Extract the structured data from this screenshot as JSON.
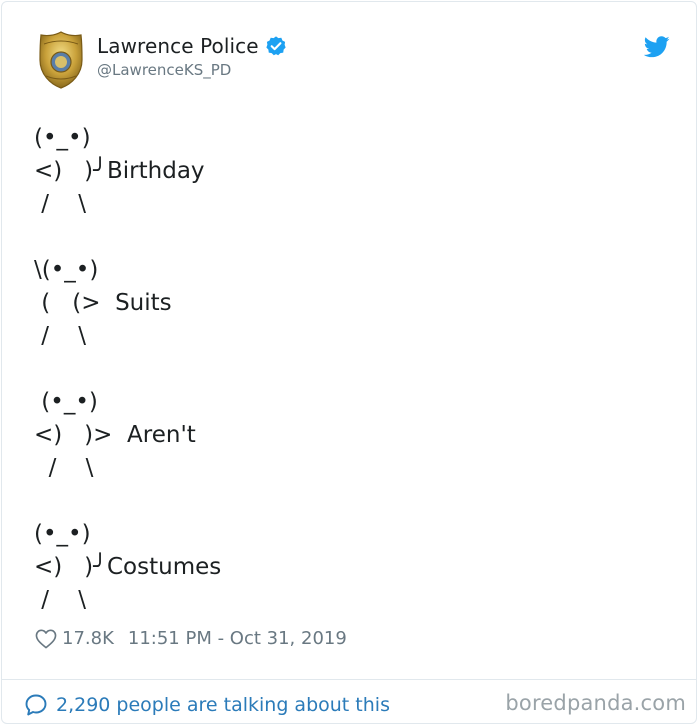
{
  "account": {
    "display_name": "Lawrence Police",
    "handle": "@LawrenceKS_PD"
  },
  "tweet": {
    "text": "(•_•)\n<)   )╯Birthday\n /    \\\n\n\\(•_•)\n (   (>  Suits\n /    \\\n\n (•_•)\n<)   )>  Aren't\n  /    \\\n\n(•_•)\n<)   )╯Costumes\n /    \\"
  },
  "meta": {
    "likes": "17.8K",
    "timestamp": "11:51 PM - Oct 31, 2019"
  },
  "footer": {
    "talking": "2,290 people are talking about this",
    "watermark": "boredpanda.com"
  },
  "colors": {
    "verified": "#1da1f2",
    "twitter_bird": "#1da1f2",
    "link": "#2b7bb9",
    "secondary_text": "#697882",
    "badge_gold": "#c9a13a"
  },
  "icons": [
    "police-badge-avatar",
    "verified-icon",
    "twitter-bird-icon",
    "heart-icon",
    "speech-bubble-icon"
  ]
}
